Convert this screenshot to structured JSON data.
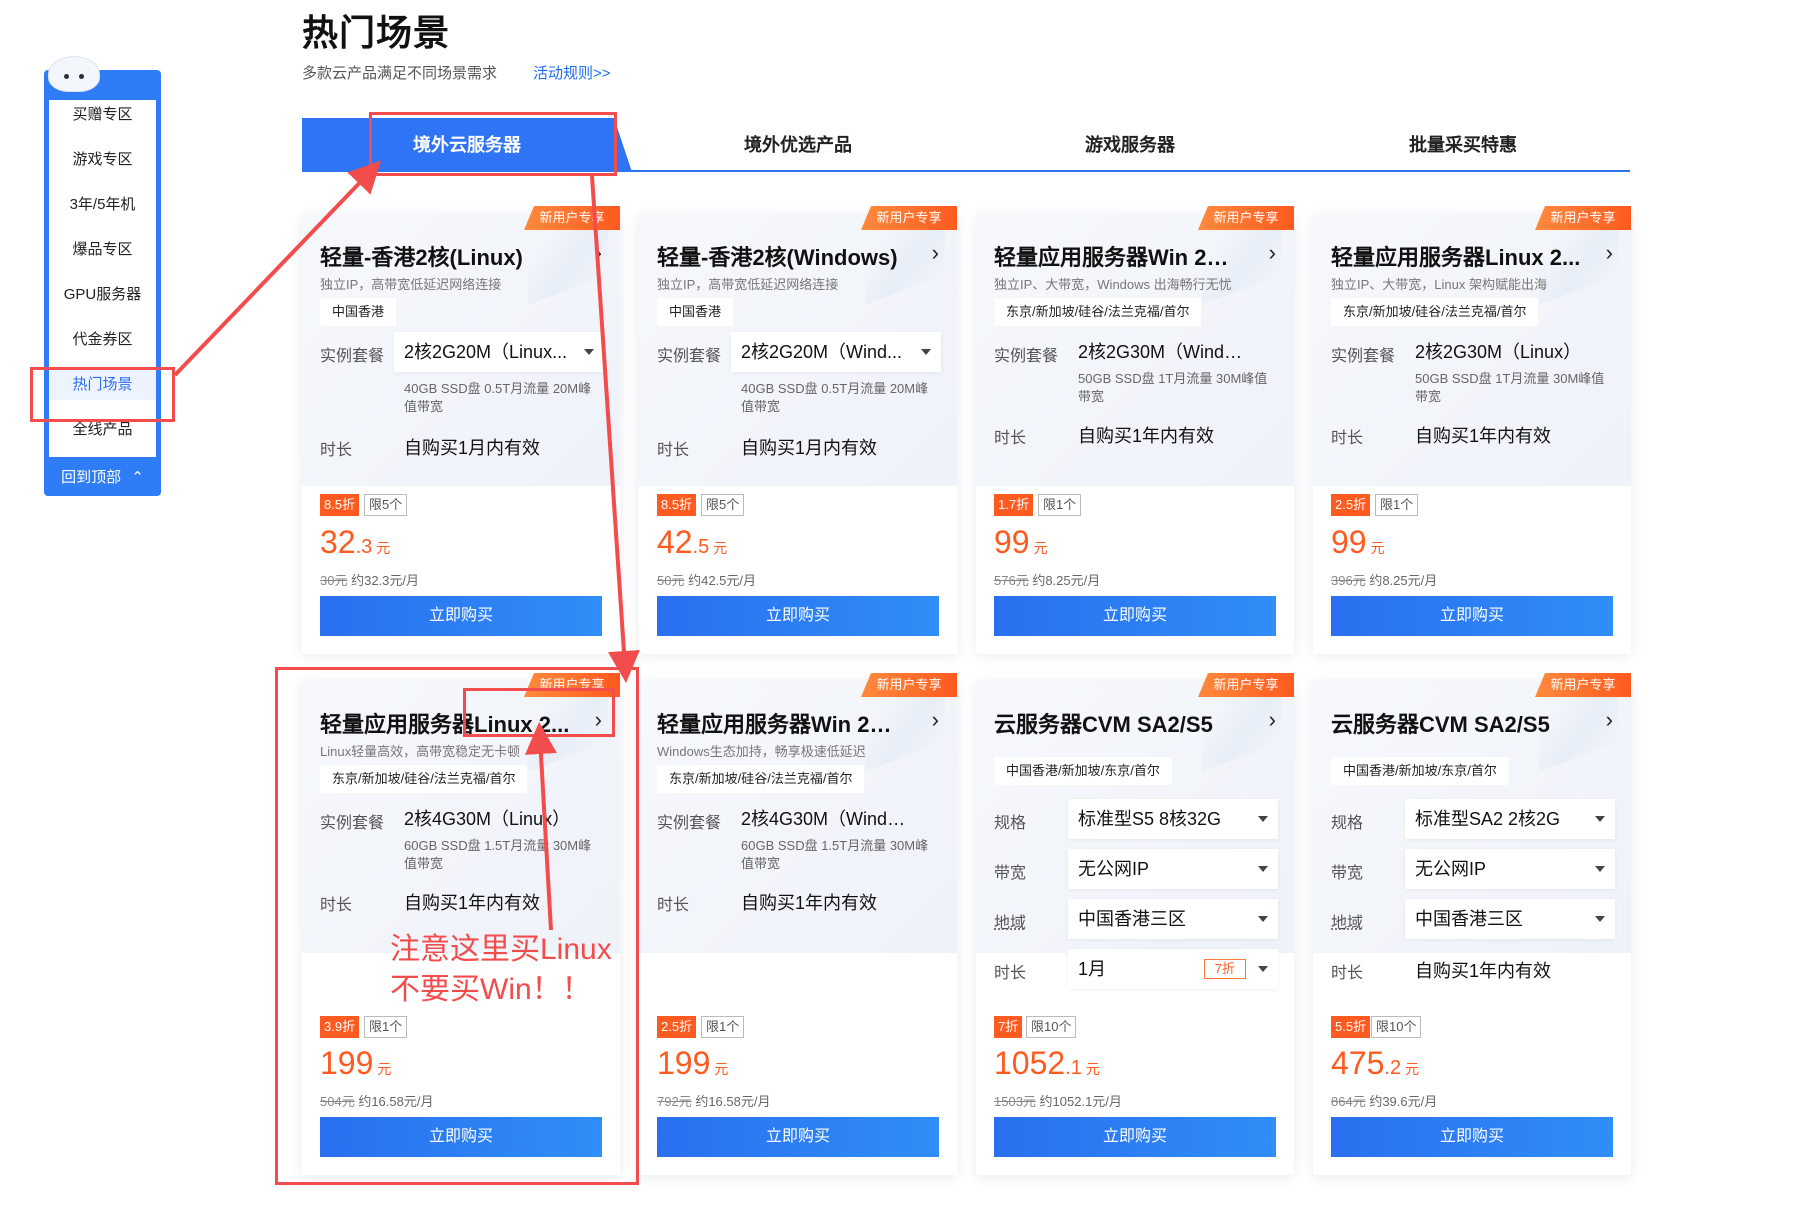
{
  "sidenav": {
    "items": [
      "买赠专区",
      "游戏专区",
      "3年/5年机",
      "爆品专区",
      "GPU服务器",
      "代金券区",
      "热门场景",
      "全线产品"
    ],
    "active_index": 6,
    "back_top": "回到顶部"
  },
  "header": {
    "title": "热门场景",
    "subtitle": "多款云产品满足不同场景需求",
    "rules_link": "活动规则>>"
  },
  "tabs": [
    "境外云服务器",
    "境外优选产品",
    "游戏服务器",
    "批量采买特惠"
  ],
  "active_tab": 0,
  "cards": [
    {
      "badge": "新用户专享",
      "title": "轻量-香港2核(Linux)",
      "desc": "独立IP，高带宽低延迟网络连接",
      "region": "中国香港",
      "spec_label": "实例套餐",
      "spec": "2核2G20M（Linux...",
      "spec_note": "40GB SSD盘 0.5T月流量 20M峰值带宽",
      "duration_label": "时长",
      "duration": "自购买1月内有效",
      "discount": "8.5折",
      "limit": "限5个",
      "price_int": "32",
      "price_dec": ".3",
      "unit": "元",
      "orig": "30元",
      "monthly": "约32.3元/月",
      "buy": "立即购买"
    },
    {
      "badge": "新用户专享",
      "title": "轻量-香港2核(Windows)",
      "desc": "独立IP，高带宽低延迟网络连接",
      "region": "中国香港",
      "spec_label": "实例套餐",
      "spec": "2核2G20M（Wind...",
      "spec_note": "40GB SSD盘 0.5T月流量 20M峰值带宽",
      "duration_label": "时长",
      "duration": "自购买1月内有效",
      "discount": "8.5折",
      "limit": "限5个",
      "price_int": "42",
      "price_dec": ".5",
      "unit": "元",
      "orig": "50元",
      "monthly": "约42.5元/月",
      "buy": "立即购买"
    },
    {
      "badge": "新用户专享",
      "title": "轻量应用服务器Win 2核...",
      "desc": "独立IP、大带宽，Windows 出海畅行无忧",
      "region": "东京/新加坡/硅谷/法兰克福/首尔",
      "spec_label": "实例套餐",
      "spec": "2核2G30M（Window...",
      "spec_note": "50GB SSD盘 1T月流量 30M峰值带宽",
      "duration_label": "时长",
      "duration": "自购买1年内有效",
      "discount": "1.7折",
      "limit": "限1个",
      "price_int": "99",
      "price_dec": "",
      "unit": "元",
      "orig": "576元",
      "monthly": "约8.25元/月",
      "buy": "立即购买"
    },
    {
      "badge": "新用户专享",
      "title": "轻量应用服务器Linux 2...",
      "desc": "独立IP、大带宽，Linux 架构赋能出海",
      "region": "东京/新加坡/硅谷/法兰克福/首尔",
      "spec_label": "实例套餐",
      "spec": "2核2G30M（Linux）",
      "spec_note": "50GB SSD盘 1T月流量 30M峰值带宽",
      "duration_label": "时长",
      "duration": "自购买1年内有效",
      "discount": "2.5折",
      "limit": "限1个",
      "price_int": "99",
      "price_dec": "",
      "unit": "元",
      "orig": "396元",
      "monthly": "约8.25元/月",
      "buy": "立即购买"
    },
    {
      "badge": "新用户专享",
      "title": "轻量应用服务器Linux 2...",
      "desc": "Linux轻量高效，高带宽稳定无卡顿",
      "region": "东京/新加坡/硅谷/法兰克福/首尔",
      "spec_label": "实例套餐",
      "spec": "2核4G30M（Linux）",
      "spec_note": "60GB SSD盘 1.5T月流量 30M峰值带宽",
      "duration_label": "时长",
      "duration": "自购买1年内有效",
      "discount": "3.9折",
      "limit": "限1个",
      "price_int": "199",
      "price_dec": "",
      "unit": "元",
      "orig": "504元",
      "monthly": "约16.58元/月",
      "buy": "立即购买"
    },
    {
      "badge": "新用户专享",
      "title": "轻量应用服务器Win 2核...",
      "desc": "Windows生态加持，畅享极速低延迟",
      "region": "东京/新加坡/硅谷/法兰克福/首尔",
      "spec_label": "实例套餐",
      "spec": "2核4G30M（Window...",
      "spec_note": "60GB SSD盘 1.5T月流量 30M峰值带宽",
      "duration_label": "时长",
      "duration": "自购买1年内有效",
      "discount": "2.5折",
      "limit": "限1个",
      "price_int": "199",
      "price_dec": "",
      "unit": "元",
      "orig": "792元",
      "monthly": "约16.58元/月",
      "buy": "立即购买"
    },
    {
      "badge": "新用户专享",
      "title": "云服务器CVM SA2/S5",
      "region": "中国香港/新加坡/东京/首尔",
      "spec_label": "规格",
      "spec": "标准型S5 8核32G",
      "bw_label": "带宽",
      "bw": "无公网IP",
      "area_label": "地域",
      "area": "中国香港三区",
      "duration_label": "时长",
      "duration": "1月",
      "duration_discount": "7折",
      "discount": "7折",
      "limit": "限10个",
      "price_int": "1052",
      "price_dec": ".1",
      "unit": "元",
      "orig": "1503元",
      "monthly": "约1052.1元/月",
      "buy": "立即购买"
    },
    {
      "badge": "新用户专享",
      "title": "云服务器CVM SA2/S5",
      "region": "中国香港/新加坡/东京/首尔",
      "spec_label": "规格",
      "spec": "标准型SA2 2核2G",
      "bw_label": "带宽",
      "bw": "无公网IP",
      "area_label": "地域",
      "area": "中国香港三区",
      "duration_label": "时长",
      "duration": "自购买1年内有效",
      "discount": "5.5折",
      "limit": "限10个",
      "price_int": "475",
      "price_dec": ".2",
      "unit": "元",
      "orig": "864元",
      "monthly": "约39.6元/月",
      "buy": "立即购买"
    }
  ],
  "annotation": {
    "line1": "注意这里买Linux",
    "line2": "不要买Win！！",
    "color": "#f24c4c"
  },
  "colors": {
    "accent": "#2e74f4",
    "price": "#ff5a1f",
    "annotation": "#f24c4c"
  }
}
